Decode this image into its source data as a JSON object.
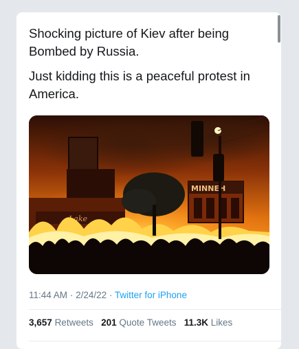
{
  "tweet": {
    "paragraphs": [
      "Shocking picture of Kiev after being Bombed by Russia.",
      "Just kidding this is a peaceful protest in America."
    ],
    "image_signs": {
      "building_sign": "MINNEH",
      "storefront_sign": "Lake"
    },
    "time": "11:44 AM",
    "date": "2/24/22",
    "source": "Twitter for iPhone",
    "separator": "·",
    "stats": {
      "retweets": {
        "count": "3,657",
        "label": "Retweets"
      },
      "quote_tweets": {
        "count": "201",
        "label": "Quote Tweets"
      },
      "likes": {
        "count": "11.3K",
        "label": "Likes"
      }
    }
  }
}
